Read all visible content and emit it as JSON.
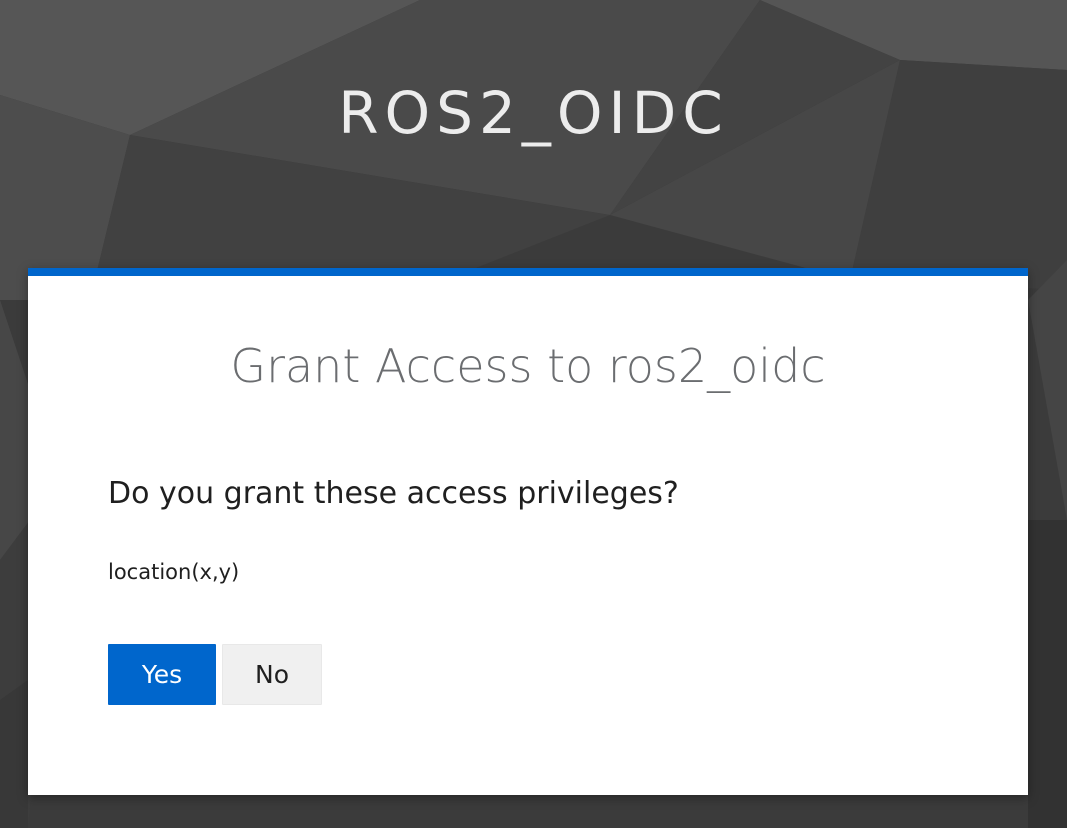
{
  "header": {
    "realm_name": "ROS2_OIDC"
  },
  "consent": {
    "title": "Grant Access to ros2_oidc",
    "question": "Do you grant these access privileges?",
    "scopes": [
      "location(x,y)"
    ],
    "yes_label": "Yes",
    "no_label": "No"
  },
  "colors": {
    "accent": "#0066cc",
    "background": "#3a3a3a",
    "card": "#ffffff",
    "no_button": "#f0f0f0"
  }
}
